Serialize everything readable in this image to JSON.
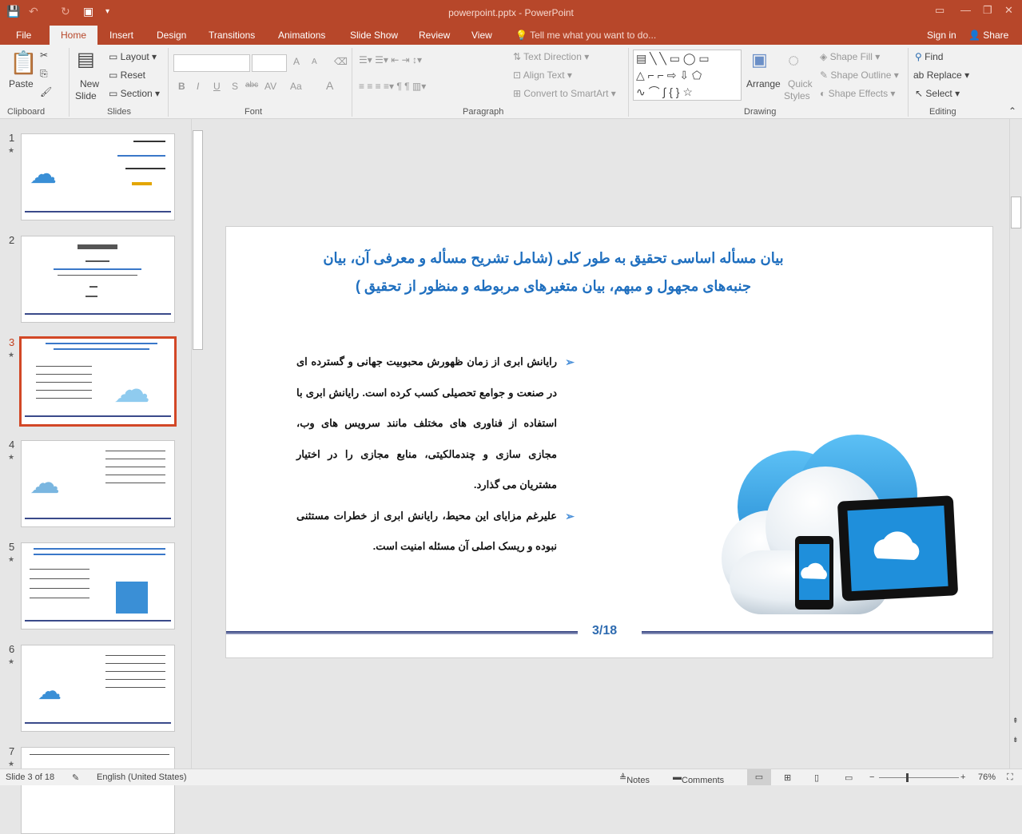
{
  "app": {
    "title": "powerpoint.pptx - PowerPoint",
    "sign_in": "Sign in",
    "share": "Share"
  },
  "tabs": [
    "File",
    "Home",
    "Insert",
    "Design",
    "Transitions",
    "Animations",
    "Slide Show",
    "Review",
    "View"
  ],
  "tell_me": "Tell me what you want to do...",
  "ribbon": {
    "clipboard": {
      "paste": "Paste",
      "group": "Clipboard"
    },
    "slides": {
      "new_slide": "New",
      "new_slide2": "Slide",
      "layout": "Layout",
      "reset": "Reset",
      "section": "Section",
      "group": "Slides"
    },
    "font": {
      "group": "Font",
      "bold": "B",
      "italic": "I",
      "underline": "U",
      "shadow": "S",
      "strike": "abc",
      "spacing": "AV",
      "case": "Aa",
      "grow": "A",
      "shrink": "A",
      "color": "A"
    },
    "paragraph": {
      "group": "Paragraph",
      "text_direction": "Text Direction",
      "align_text": "Align Text",
      "smartart": "Convert to SmartArt"
    },
    "drawing": {
      "group": "Drawing",
      "arrange": "Arrange",
      "quick": "Quick",
      "styles": "Styles",
      "fill": "Shape Fill",
      "outline": "Shape Outline",
      "effects": "Shape Effects"
    },
    "editing": {
      "group": "Editing",
      "find": "Find",
      "replace": "Replace",
      "select": "Select"
    }
  },
  "thumbnails": [
    {
      "num": "1"
    },
    {
      "num": "2"
    },
    {
      "num": "3"
    },
    {
      "num": "4"
    },
    {
      "num": "5"
    },
    {
      "num": "6"
    },
    {
      "num": "7"
    }
  ],
  "slide": {
    "title": "بیان مسأله اساسی تحقیق به طور کلی (شامل تشریح مسأله و معرفی آن، بیان جنبه‌های مجهول و مبهم، بیان متغیرهای مربوطه و منظور از تحقیق )",
    "bullets": [
      "رایانش ابری از زمان ظهورش محبوبیت جهانی و گسترده ای در صنعت و جوامع تحصیلی کسب کرده است. رایانش ابری با استفاده از فناوری های مختلف مانند سرویس های وب، مجازی سازی و چندمالکیتی، منابع مجازی را در اختیار مشتریان می گذارد.",
      "علیرغم مزایای این محیط، رایانش ابری از خطرات مستثنی نبوده و ریسک اصلی آن مسئله امنیت است."
    ],
    "page": "3/18"
  },
  "status": {
    "slide": "Slide 3 of 18",
    "language": "English (United States)",
    "notes": "Notes",
    "comments": "Comments",
    "zoom": "76%"
  },
  "colors": {
    "accent": "#b7472a",
    "title": "#1f6fbf"
  }
}
